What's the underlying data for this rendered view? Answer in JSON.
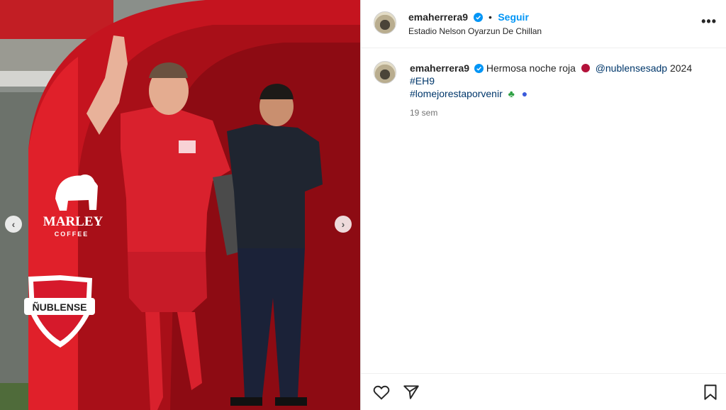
{
  "post": {
    "username": "emaherrera9",
    "follow_label": "Seguir",
    "separator": "•",
    "location": "Estadio Nelson Oyarzun De Chillan",
    "caption": {
      "username": "emaherrera9",
      "text": "Hermosa noche roja",
      "mention": "@nublensesadp",
      "year": "2024",
      "hashtag1": "#EH9",
      "hashtag2": "#lomejorestaporvenir"
    },
    "timestamp": "19 sem"
  },
  "media": {
    "brand_text": "MARLEY",
    "brand_sub": "COFFEE",
    "club_text": "ÑUBLENSE"
  },
  "colors": {
    "accent": "#0095f6",
    "link": "#00376b",
    "club_red": "#d6192b"
  },
  "icons": {
    "like": "heart-icon",
    "share": "paper-plane-icon",
    "save": "bookmark-icon",
    "more": "more-options-icon",
    "verified": "verified-badge-icon"
  }
}
